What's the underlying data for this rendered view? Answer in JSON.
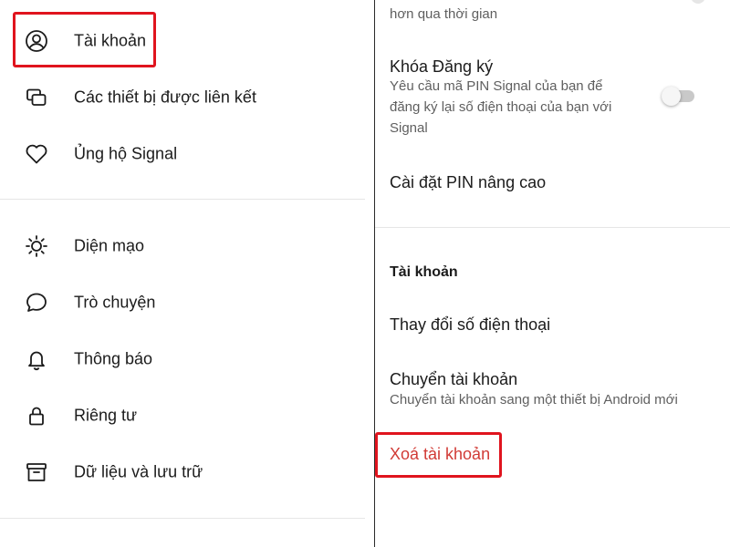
{
  "left_menu": {
    "items": [
      {
        "icon": "account-circle-icon",
        "label": "Tài khoản"
      },
      {
        "icon": "linked-devices-icon",
        "label": "Các thiết bị được liên kết"
      },
      {
        "icon": "heart-icon",
        "label": "Ủng hộ Signal"
      },
      {
        "icon": "sun-icon",
        "label": "Diện mạo"
      },
      {
        "icon": "chat-bubble-icon",
        "label": "Trò chuyện"
      },
      {
        "icon": "bell-icon",
        "label": "Thông báo"
      },
      {
        "icon": "lock-icon",
        "label": "Riêng tư"
      },
      {
        "icon": "archive-box-icon",
        "label": "Dữ liệu và lưu trữ"
      }
    ]
  },
  "right_settings": {
    "partial_top_text": "hơn qua thời gian",
    "registration_lock": {
      "title": "Khóa Đăng ký",
      "description_lines": [
        "Yêu cầu mã PIN Signal của bạn để",
        "đăng ký lại số điện thoại của bạn với",
        "Signal"
      ],
      "enabled": false
    },
    "advanced_pin": "Cài đặt PIN nâng cao",
    "account_section": {
      "header": "Tài khoản",
      "change_phone": "Thay đổi số điện thoại",
      "transfer": {
        "title": "Chuyển tài khoản",
        "description": "Chuyển tài khoản sang một thiết bị Android mới"
      },
      "delete": "Xoá tài khoản"
    }
  },
  "colors": {
    "highlight": "#e0141e",
    "danger_text": "#d13b36",
    "divider": "#2a2a2a"
  }
}
